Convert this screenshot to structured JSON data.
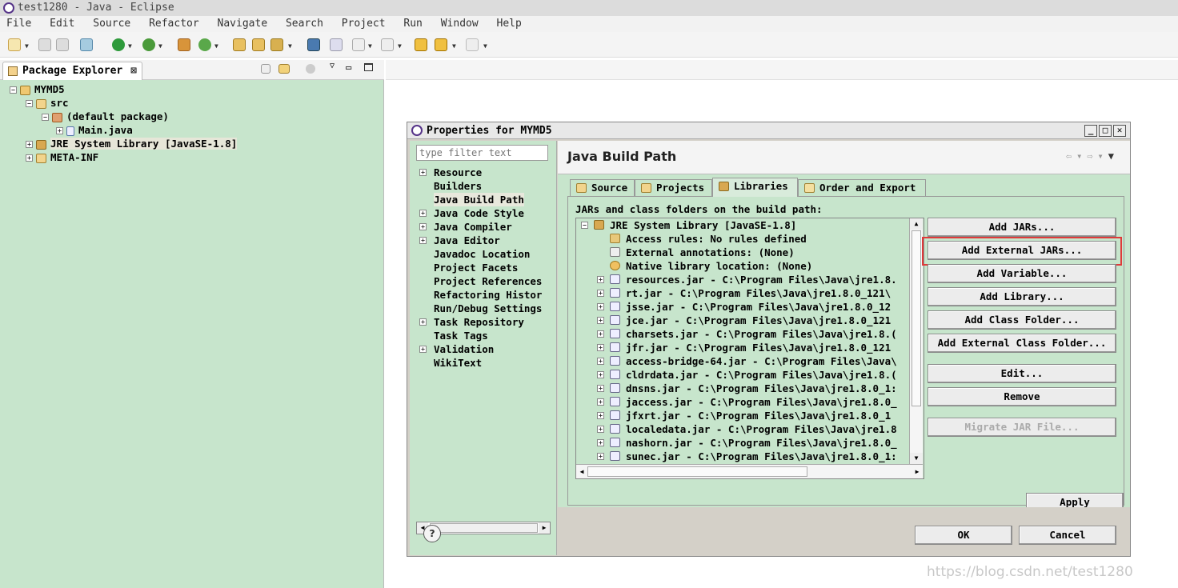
{
  "window": {
    "title": "test1280 - Java - Eclipse"
  },
  "menu": [
    "File",
    "Edit",
    "Source",
    "Refactor",
    "Navigate",
    "Search",
    "Project",
    "Run",
    "Window",
    "Help"
  ],
  "package_explorer": {
    "tab_label": "Package Explorer",
    "close": "⊠",
    "tree": [
      {
        "label": "MYMD5",
        "level": 0
      },
      {
        "label": "src",
        "level": 1
      },
      {
        "label": "(default package)",
        "level": 2
      },
      {
        "label": "Main.java",
        "level": 3
      },
      {
        "label": "JRE System Library [JavaSE-1.8]",
        "level": 1
      },
      {
        "label": "META-INF",
        "level": 1
      }
    ]
  },
  "dialog": {
    "title": "Properties for MYMD5",
    "filter_placeholder": "type filter text",
    "nav_items": [
      {
        "label": "Resource",
        "expandable": true
      },
      {
        "label": "Builders",
        "expandable": false
      },
      {
        "label": "Java Build Path",
        "expandable": false
      },
      {
        "label": "Java Code Style",
        "expandable": true
      },
      {
        "label": "Java Compiler",
        "expandable": true
      },
      {
        "label": "Java Editor",
        "expandable": true
      },
      {
        "label": "Javadoc Location",
        "expandable": false
      },
      {
        "label": "Project Facets",
        "expandable": false
      },
      {
        "label": "Project References",
        "expandable": false
      },
      {
        "label": "Refactoring Histor",
        "expandable": false
      },
      {
        "label": "Run/Debug Settings",
        "expandable": false
      },
      {
        "label": "Task Repository",
        "expandable": true
      },
      {
        "label": "Task Tags",
        "expandable": false
      },
      {
        "label": "Validation",
        "expandable": true
      },
      {
        "label": "WikiText",
        "expandable": false
      }
    ],
    "page_title": "Java Build Path",
    "tabs": [
      "Source",
      "Projects",
      "Libraries",
      "Order and Export"
    ],
    "selected_tab": "Libraries",
    "jars_label": "JARs and class folders on the build path:",
    "library_tree": {
      "root": "JRE System Library [JavaSE-1.8]",
      "attributes": [
        "Access rules: No rules defined",
        "External annotations: (None)",
        "Native library location: (None)"
      ],
      "jars": [
        "resources.jar - C:\\Program Files\\Java\\jre1.8.",
        "rt.jar - C:\\Program Files\\Java\\jre1.8.0_121\\",
        "jsse.jar - C:\\Program Files\\Java\\jre1.8.0_12",
        "jce.jar - C:\\Program Files\\Java\\jre1.8.0_121",
        "charsets.jar - C:\\Program Files\\Java\\jre1.8.(",
        "jfr.jar - C:\\Program Files\\Java\\jre1.8.0_121",
        "access-bridge-64.jar - C:\\Program Files\\Java\\",
        "cldrdata.jar - C:\\Program Files\\Java\\jre1.8.(",
        "dnsns.jar - C:\\Program Files\\Java\\jre1.8.0_1:",
        "jaccess.jar - C:\\Program Files\\Java\\jre1.8.0_",
        "jfxrt.jar - C:\\Program Files\\Java\\jre1.8.0_1",
        "localedata.jar - C:\\Program Files\\Java\\jre1.8",
        "nashorn.jar - C:\\Program Files\\Java\\jre1.8.0_",
        "sunec.jar - C:\\Program Files\\Java\\jre1.8.0_1:"
      ]
    },
    "buttons": {
      "add_jars": "Add JARs...",
      "add_external_jars": "Add External JARs...",
      "add_variable": "Add Variable...",
      "add_library": "Add Library...",
      "add_class_folder": "Add Class Folder...",
      "add_external_class_folder": "Add External Class Folder...",
      "edit": "Edit...",
      "remove": "Remove",
      "migrate_jar": "Migrate JAR File...",
      "apply": "Apply",
      "ok": "OK",
      "cancel": "Cancel"
    },
    "help": "?"
  },
  "watermark": "https://blog.csdn.net/test1280",
  "colors": {
    "tree_bg": "#c7e5cc",
    "highlight": "#e03a3a",
    "dialog_bg": "#d4d0c8"
  }
}
